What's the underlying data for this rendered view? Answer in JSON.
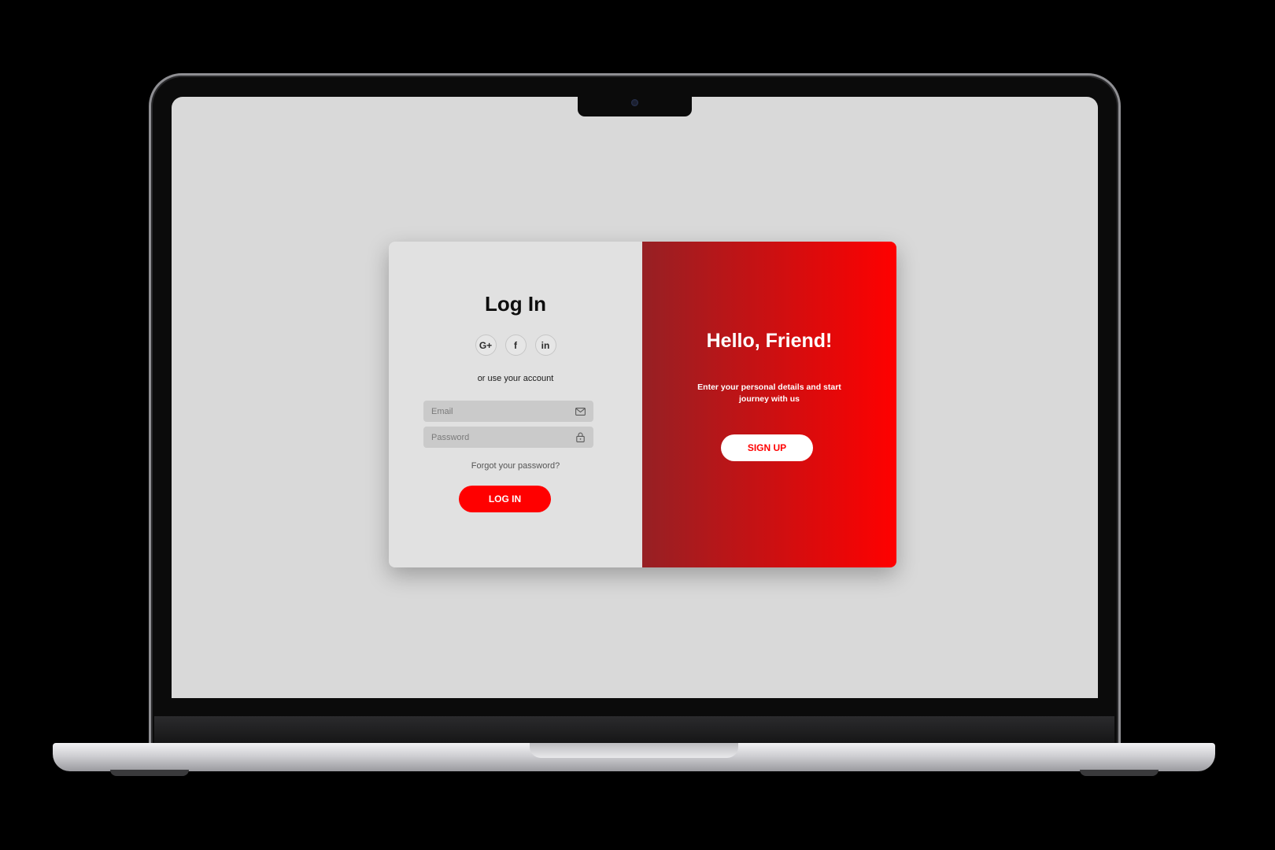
{
  "colors": {
    "accent": "#ff0000",
    "gradient_start": "#962024",
    "gradient_end": "#ff0000",
    "screen_bg": "#d9d9d9",
    "panel_bg": "#e1e1e1"
  },
  "login": {
    "title": "Log In",
    "social": [
      {
        "icon": "google-plus-icon",
        "glyph": "G+"
      },
      {
        "icon": "facebook-icon",
        "glyph": "f"
      },
      {
        "icon": "linkedin-icon",
        "glyph": "in"
      }
    ],
    "alt_text": "or use your account",
    "email": {
      "placeholder": "Email",
      "value": "",
      "icon": "mail-icon"
    },
    "password": {
      "placeholder": "Password",
      "value": "",
      "icon": "lock-icon"
    },
    "forgot_label": "Forgot your password?",
    "submit_label": "LOG IN"
  },
  "signup": {
    "title": "Hello, Friend!",
    "subtitle": "Enter your personal details and start journey with us",
    "button_label": "SIGN UP"
  }
}
